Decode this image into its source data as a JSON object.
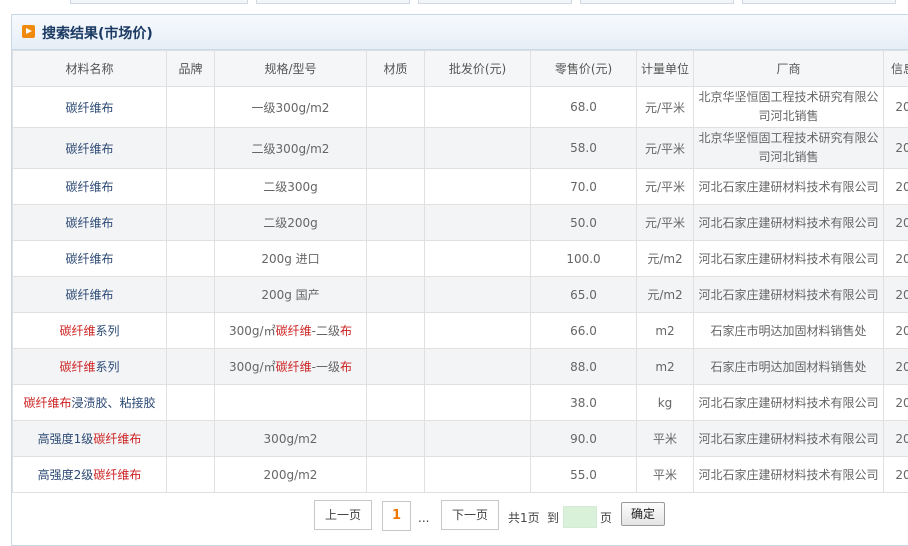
{
  "panel": {
    "title": "搜索结果(市场价)"
  },
  "columns": [
    "材料名称",
    "品牌",
    "规格/型号",
    "材质",
    "批发价(元)",
    "零售价(元)",
    "计量单位",
    "厂商",
    "信息"
  ],
  "rows": [
    {
      "name": [
        {
          "t": "碳纤维布"
        }
      ],
      "brand": "",
      "spec": [
        {
          "t": "一级300g/m2"
        }
      ],
      "material": "",
      "wholesale": "",
      "retail": "68.0",
      "unit": "元/平米",
      "vendor": "北京华坚恒固工程技术研究有限公司河北销售",
      "info": "20"
    },
    {
      "name": [
        {
          "t": "碳纤维布"
        }
      ],
      "brand": "",
      "spec": [
        {
          "t": "二级300g/m2"
        }
      ],
      "material": "",
      "wholesale": "",
      "retail": "58.0",
      "unit": "元/平米",
      "vendor": "北京华坚恒固工程技术研究有限公司河北销售",
      "info": "20"
    },
    {
      "name": [
        {
          "t": "碳纤维布"
        }
      ],
      "brand": "",
      "spec": [
        {
          "t": "二级300g"
        }
      ],
      "material": "",
      "wholesale": "",
      "retail": "70.0",
      "unit": "元/平米",
      "vendor": "河北石家庄建研材料技术有限公司",
      "info": "20"
    },
    {
      "name": [
        {
          "t": "碳纤维布"
        }
      ],
      "brand": "",
      "spec": [
        {
          "t": "二级200g"
        }
      ],
      "material": "",
      "wholesale": "",
      "retail": "50.0",
      "unit": "元/平米",
      "vendor": "河北石家庄建研材料技术有限公司",
      "info": "20"
    },
    {
      "name": [
        {
          "t": "碳纤维布"
        }
      ],
      "brand": "",
      "spec": [
        {
          "t": "200g 进口"
        }
      ],
      "material": "",
      "wholesale": "",
      "retail": "100.0",
      "unit": "元/m2",
      "vendor": "河北石家庄建研材料技术有限公司",
      "info": "20"
    },
    {
      "name": [
        {
          "t": "碳纤维布"
        }
      ],
      "brand": "",
      "spec": [
        {
          "t": "200g 国产"
        }
      ],
      "material": "",
      "wholesale": "",
      "retail": "65.0",
      "unit": "元/m2",
      "vendor": "河北石家庄建研材料技术有限公司",
      "info": "20"
    },
    {
      "name": [
        {
          "t": "碳纤维",
          "hl": true
        },
        {
          "t": "系列"
        }
      ],
      "brand": "",
      "spec": [
        {
          "t": "300g/㎡"
        },
        {
          "t": "碳纤维",
          "hl": true
        },
        {
          "t": "-二级"
        },
        {
          "t": "布",
          "hl": true
        }
      ],
      "material": "",
      "wholesale": "",
      "retail": "66.0",
      "unit": "m2",
      "vendor": "石家庄市明达加固材料销售处",
      "info": "20"
    },
    {
      "name": [
        {
          "t": "碳纤维",
          "hl": true
        },
        {
          "t": "系列"
        }
      ],
      "brand": "",
      "spec": [
        {
          "t": "300g/㎡"
        },
        {
          "t": "碳纤维",
          "hl": true
        },
        {
          "t": "-一级"
        },
        {
          "t": "布",
          "hl": true
        }
      ],
      "material": "",
      "wholesale": "",
      "retail": "88.0",
      "unit": "m2",
      "vendor": "石家庄市明达加固材料销售处",
      "info": "20"
    },
    {
      "name": [
        {
          "t": "碳纤维布",
          "hl": true
        },
        {
          "t": "浸渍胶、粘接胶"
        }
      ],
      "brand": "",
      "spec": [
        {
          "t": ""
        }
      ],
      "material": "",
      "wholesale": "",
      "retail": "38.0",
      "unit": "kg",
      "vendor": "河北石家庄建研材料技术有限公司",
      "info": "20"
    },
    {
      "name": [
        {
          "t": "高强度1级"
        },
        {
          "t": "碳纤维布",
          "hl": true
        }
      ],
      "brand": "",
      "spec": [
        {
          "t": "300g/m2"
        }
      ],
      "material": "",
      "wholesale": "",
      "retail": "90.0",
      "unit": "平米",
      "vendor": "河北石家庄建研材料技术有限公司",
      "info": "20"
    },
    {
      "name": [
        {
          "t": "高强度2级"
        },
        {
          "t": "碳纤维布",
          "hl": true
        }
      ],
      "brand": "",
      "spec": [
        {
          "t": "200g/m2"
        }
      ],
      "material": "",
      "wholesale": "",
      "retail": "55.0",
      "unit": "平米",
      "vendor": "河北石家庄建研材料技术有限公司",
      "info": "20"
    }
  ],
  "pager": {
    "prev_label": "上一页",
    "current_page": "1",
    "ellipsis": "...",
    "next_label": "下一页",
    "total_label": "共1页",
    "goto_label": "到",
    "page_suffix": "页",
    "input_value": "",
    "confirm_label": "确定"
  },
  "colors": {
    "title": "#1b3a63",
    "highlight": "#cc2222",
    "current_page": "#f07800",
    "name_text": "#2d4a74"
  }
}
